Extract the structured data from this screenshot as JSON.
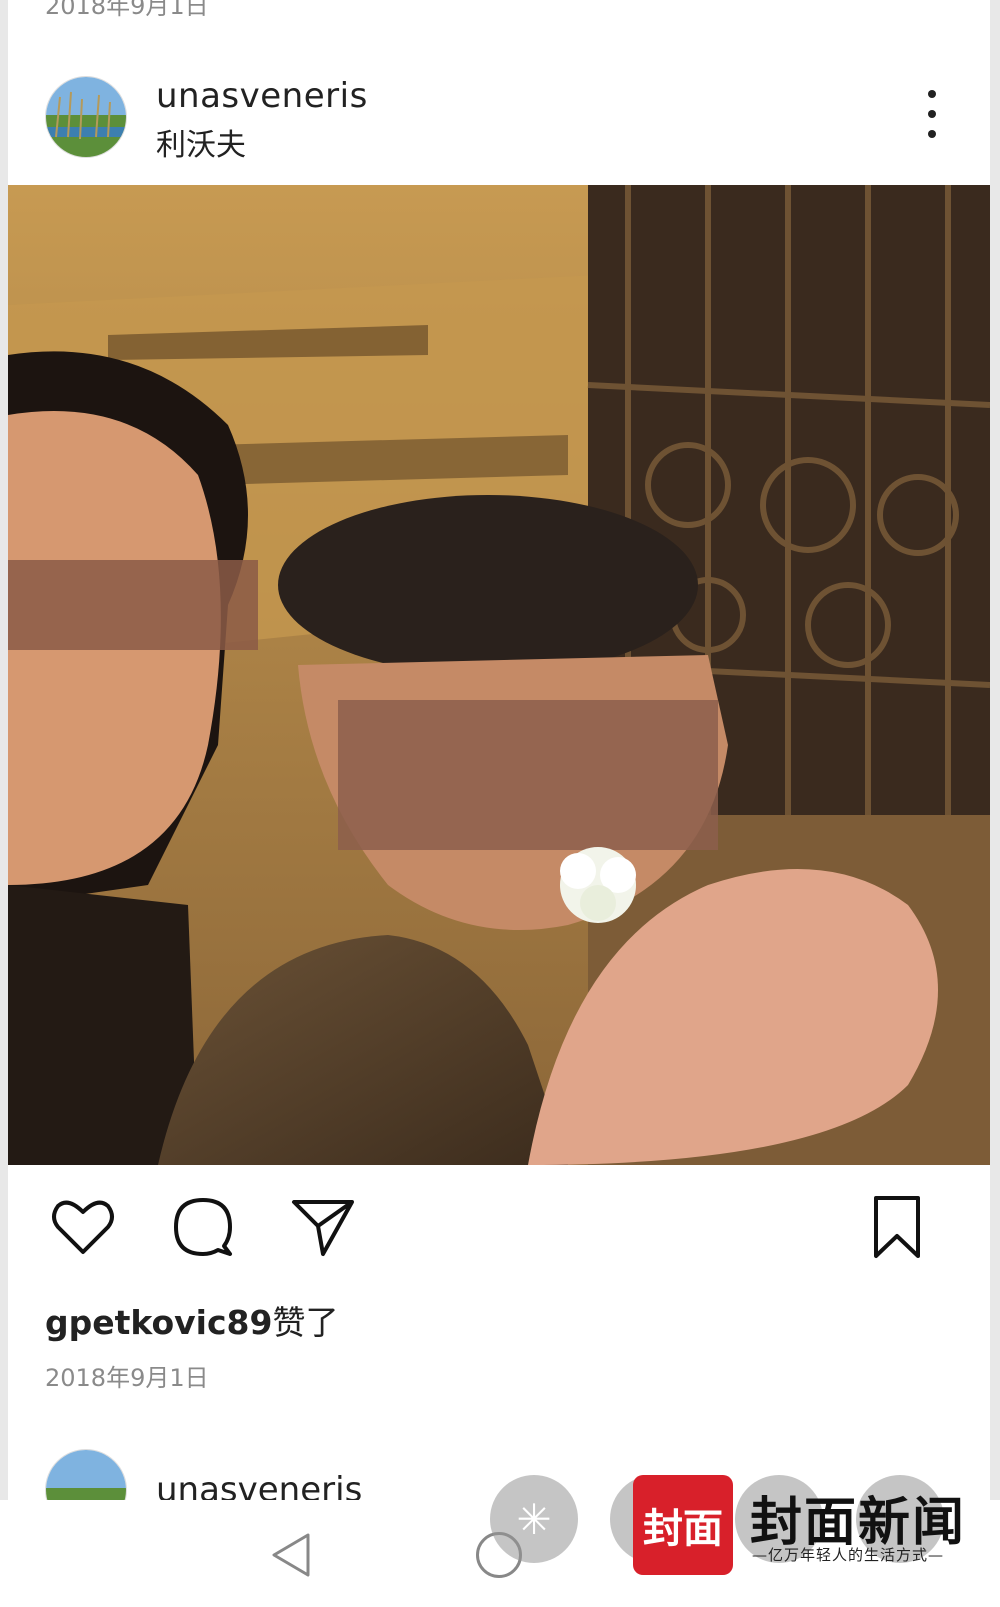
{
  "feed": {
    "top_partial_date": "2018年9月1日"
  },
  "post": {
    "username": "unasveneris",
    "location": "利沃夫",
    "liked_by": "gpetkovic89",
    "liked_suffix": "赞了",
    "date": "2018年9月1日"
  },
  "next_post": {
    "username": "unasveneris"
  },
  "icons": {
    "more": "more-vertical-icon",
    "like": "heart-icon",
    "comment": "comment-bubble-icon",
    "share": "send-paper-plane-icon",
    "save": "bookmark-icon",
    "nav_back": "triangle-back-icon",
    "nav_home": "circle-home-icon"
  },
  "watermark": {
    "logo_text": "封面",
    "title": "封面新闻",
    "slogan": "—亿万年轻人的生活方式—",
    "brand_color": "#d8202a"
  }
}
